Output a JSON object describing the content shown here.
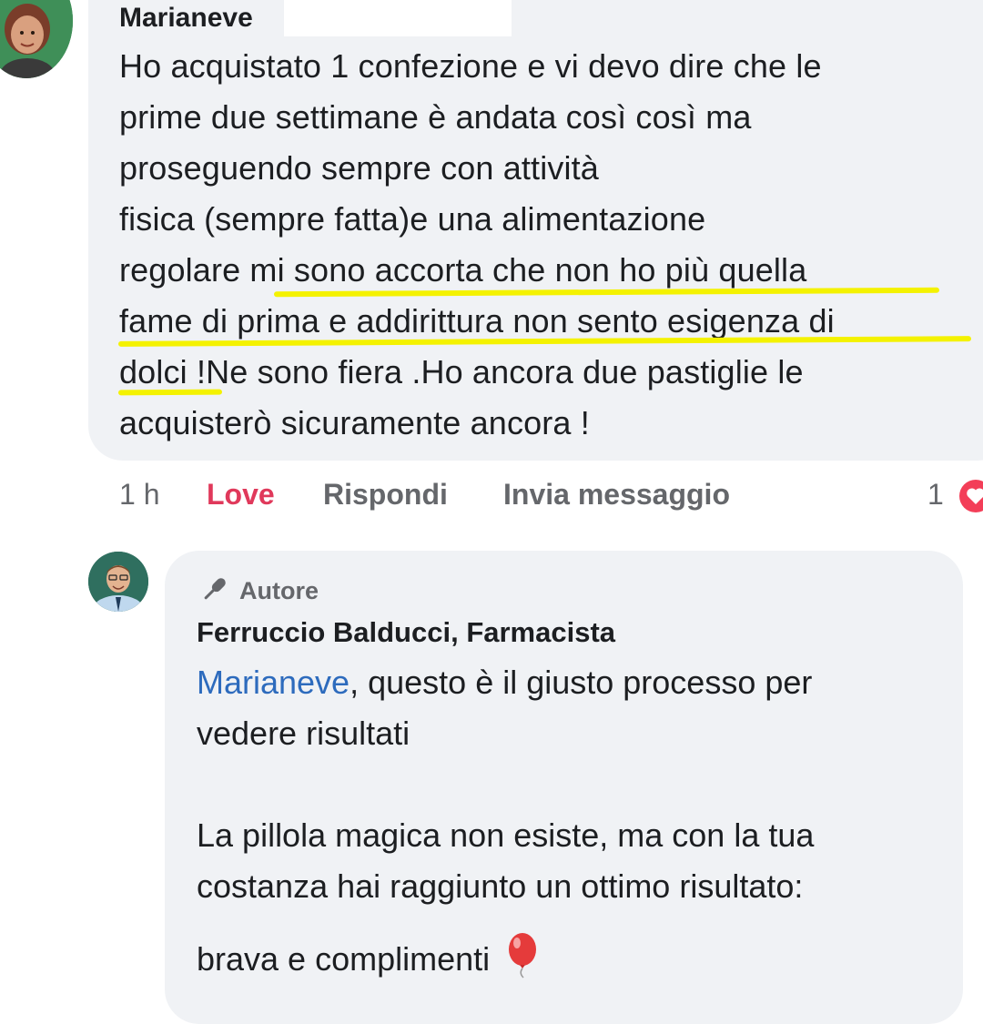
{
  "comment": {
    "author": "Marianeve",
    "lines": [
      "Ho acquistato 1 confezione e vi devo dire che le",
      "prime due settimane è andata così così ma",
      "proseguendo sempre con attività",
      " fisica (sempre fatta)e una alimentazione",
      "regolare mi sono accorta che non ho più quella",
      "fame di prima e addirittura non sento esigenza di",
      "dolci !Ne sono fiera .Ho ancora due pastiglie le",
      "acquisterò sicuramente ancora !"
    ],
    "time": "1 h",
    "actions": {
      "love": "Love",
      "reply": "Rispondi",
      "message": "Invia messaggio"
    },
    "reaction_count": "1",
    "reaction_icon": "heart-icon"
  },
  "reply": {
    "badge": "Autore",
    "badge_icon": "microphone-icon",
    "author": "Ferruccio Balducci, Farmacista",
    "mention": "Marianeve",
    "lines": [
      ", questo è il giusto processo per",
      "vedere risultati",
      "",
      "La pillola magica non esiste, ma con la tua",
      "costanza hai raggiunto un ottimo risultato:",
      "brava e complimenti"
    ],
    "emoji_icon": "balloon-icon"
  },
  "colors": {
    "bubble": "#f0f2f5",
    "love": "#e0395b",
    "mention": "#2d6bbd",
    "highlight": "#f4f200",
    "meta": "#65676b"
  }
}
